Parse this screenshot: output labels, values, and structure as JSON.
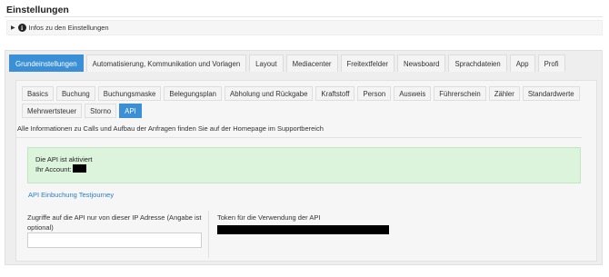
{
  "page": {
    "title": "Einstellungen",
    "info_toggle": "Infos zu den Einstellungen"
  },
  "main_tabs": [
    {
      "label": "Grundeinstellungen",
      "active": true
    },
    {
      "label": "Automatisierung, Kommunikation und Vorlagen",
      "active": false
    },
    {
      "label": "Layout",
      "active": false
    },
    {
      "label": "Mediacenter",
      "active": false
    },
    {
      "label": "Freitextfelder",
      "active": false
    },
    {
      "label": "Newsboard",
      "active": false
    },
    {
      "label": "Sprachdateien",
      "active": false
    },
    {
      "label": "App",
      "active": false
    },
    {
      "label": "Profi",
      "active": false
    }
  ],
  "sub_tabs": [
    {
      "label": "Basics",
      "active": false
    },
    {
      "label": "Buchung",
      "active": false
    },
    {
      "label": "Buchungsmaske",
      "active": false
    },
    {
      "label": "Belegungsplan",
      "active": false
    },
    {
      "label": "Abholung und Rückgabe",
      "active": false
    },
    {
      "label": "Kraftstoff",
      "active": false
    },
    {
      "label": "Person",
      "active": false
    },
    {
      "label": "Ausweis",
      "active": false
    },
    {
      "label": "Führerschein",
      "active": false
    },
    {
      "label": "Zähler",
      "active": false
    },
    {
      "label": "Standardwerte",
      "active": false
    },
    {
      "label": "Mehrwertsteuer",
      "active": false
    },
    {
      "label": "Storno",
      "active": false
    },
    {
      "label": "API",
      "active": true
    }
  ],
  "api": {
    "info_text": "Alle Informationen zu Calls und Aufbau der Anfragen finden Sie auf der Homepage im Supportbereich",
    "status_line": "Die API ist aktiviert",
    "account_label": "Ihr Account:",
    "link_text": "API Einbuchung Testjourney",
    "ip_label": "Zugriffe auf die API nur von dieser IP Adresse (Angabe ist optional)",
    "ip_value": "",
    "token_label": "Token für die Verwendung der API"
  },
  "colors": {
    "accent": "#3a8fd6",
    "success_bg": "#dcf3dc",
    "link": "#2a7cc7"
  }
}
